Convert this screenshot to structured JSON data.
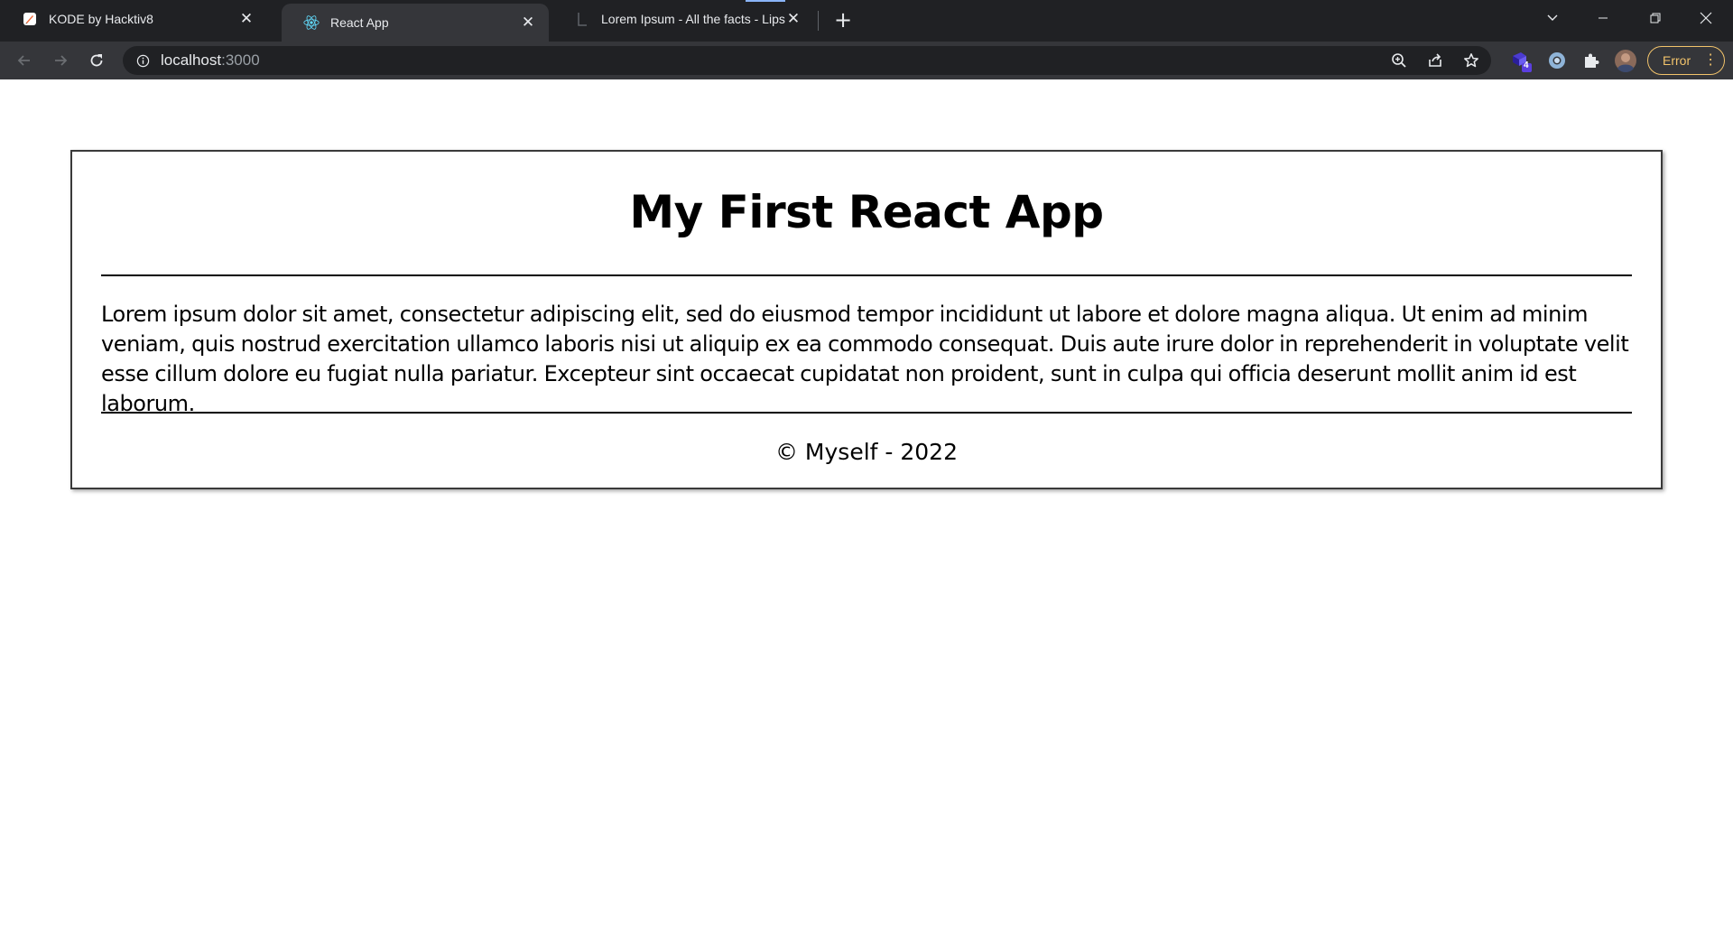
{
  "browser": {
    "tabs": [
      {
        "title": "KODE by Hacktiv8",
        "favicon": "kode-logo-icon",
        "active": false
      },
      {
        "title": "React App",
        "favicon": "react-logo-icon",
        "active": true
      },
      {
        "title": "Lorem Ipsum - All the facts - Lipsum generator",
        "favicon": "document-icon",
        "active": false
      }
    ],
    "address": {
      "host": "localhost",
      "port": ":3000"
    },
    "extension_badge": "4",
    "error_label": "Error",
    "colors": {
      "frame": "#202124",
      "toolbar": "#35363a",
      "error": "#f2c36b"
    }
  },
  "page": {
    "title": "My First React App",
    "body": "Lorem ipsum dolor sit amet, consectetur adipiscing elit, sed do eiusmod tempor incididunt ut labore et dolore magna aliqua. Ut enim ad minim veniam, quis nostrud exercitation ullamco laboris nisi ut aliquip ex ea commodo consequat. Duis aute irure dolor in reprehenderit in voluptate velit esse cillum dolore eu fugiat nulla pariatur. Excepteur sint occaecat cupidatat non proident, sunt in culpa qui officia deserunt mollit anim id est laborum.",
    "footer": "© Myself - 2022"
  }
}
